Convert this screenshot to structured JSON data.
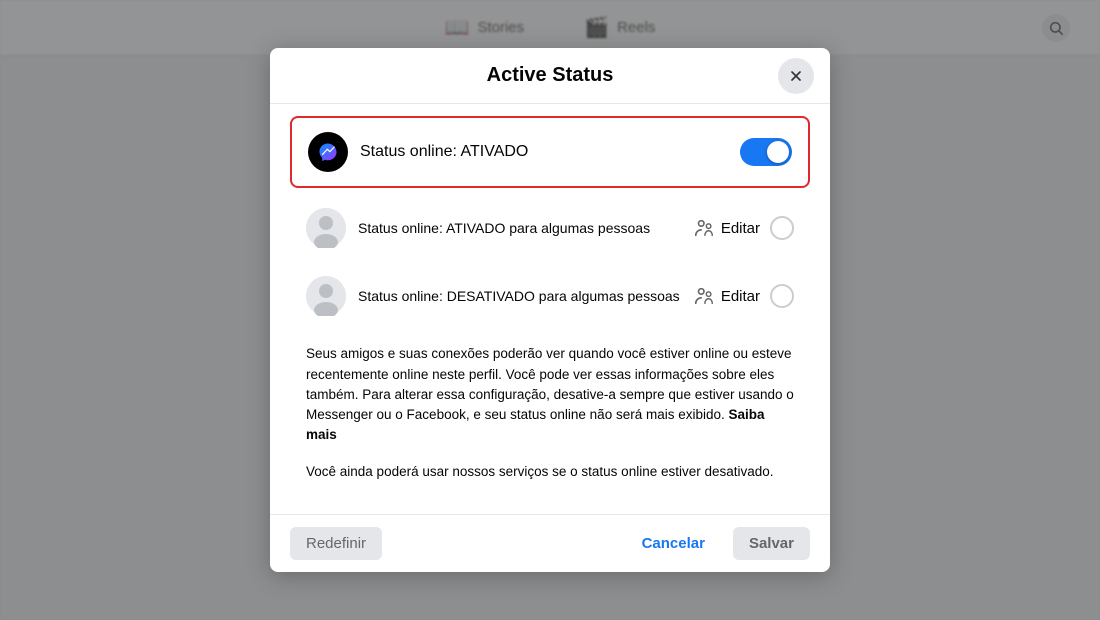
{
  "background": {
    "tab1_label": "Stories",
    "tab2_label": "Reels"
  },
  "modal": {
    "title": "Active Status",
    "close_label": "×",
    "status_main_label": "Status online: ATIVADO",
    "toggle_state": "on",
    "row1_label": "Status online: ATIVADO para algumas pessoas",
    "row1_edit": "Editar",
    "row2_label": "Status online: DESATIVADO para algumas pessoas",
    "row2_edit": "Editar",
    "description_main": "Seus amigos e suas conexões poderão ver quando você estiver online ou esteve recentemente online neste perfil. Você pode ver essas informações sobre eles também. Para alterar essa configuração, desative-a sempre que estiver usando o Messenger ou o Facebook, e seu status online não será mais exibido.",
    "description_saiba_mais": "Saiba mais",
    "description_secondary": "Você ainda poderá usar nossos serviços se o status online estiver desativado.",
    "btn_reset": "Redefinir",
    "btn_cancel": "Cancelar",
    "btn_save": "Salvar"
  },
  "icons": {
    "messenger": "messenger-icon",
    "person1": "person-icon",
    "person2": "person-icon",
    "close": "close-icon",
    "search": "search-icon",
    "people_edit1": "people-edit-icon",
    "people_edit2": "people-edit-icon"
  }
}
